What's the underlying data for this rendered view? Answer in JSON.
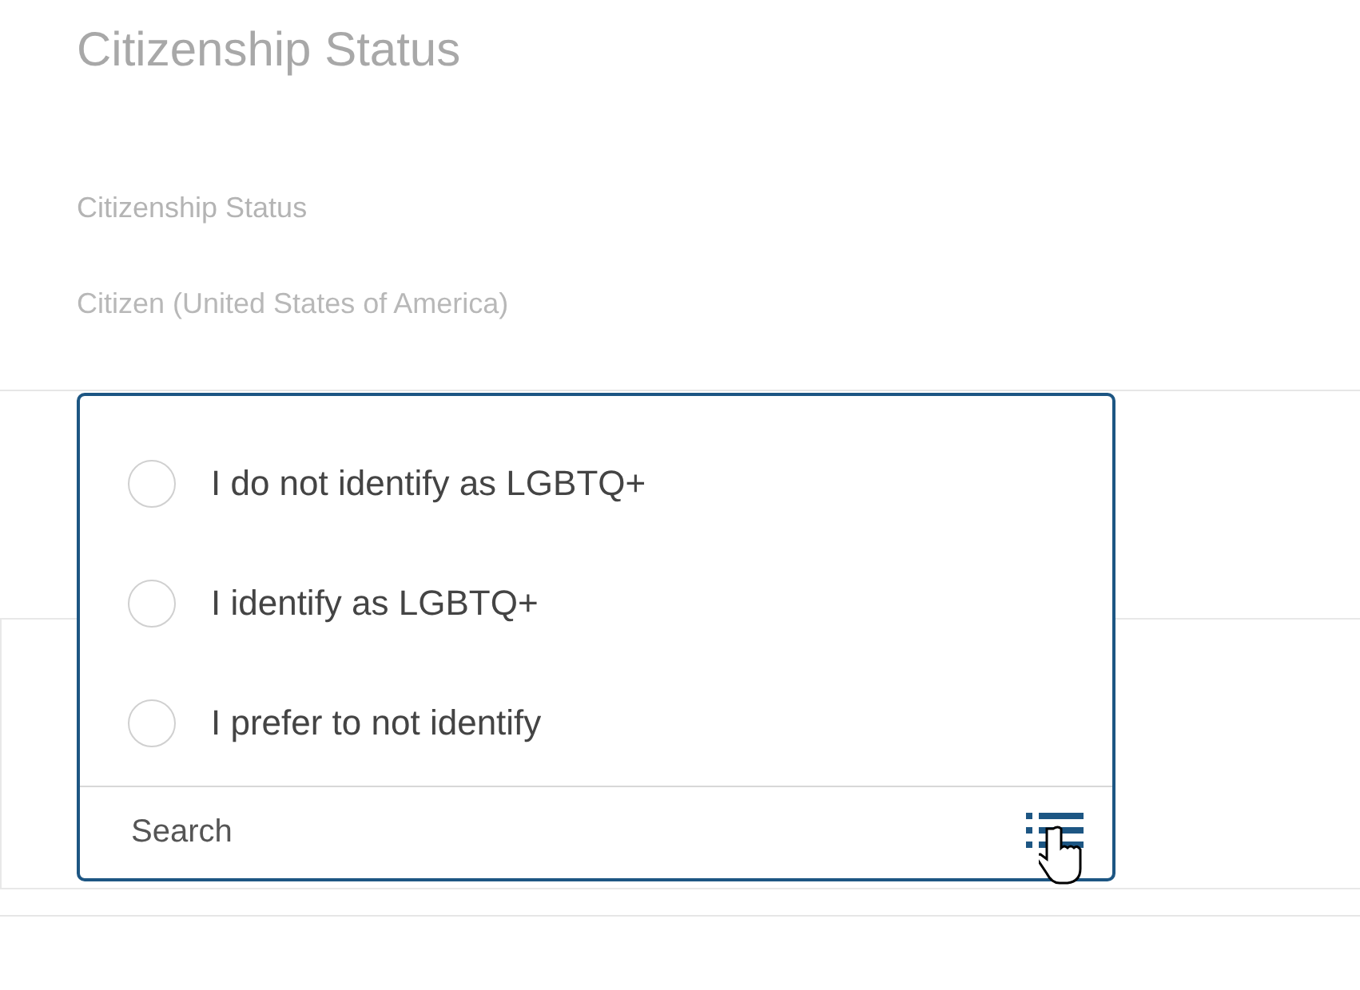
{
  "section": {
    "title": "Citizenship Status"
  },
  "field": {
    "label": "Citizenship Status",
    "value": "Citizen (United States of America)"
  },
  "dropdown": {
    "options": [
      {
        "label": "I do not identify as LGBTQ+",
        "selected": false
      },
      {
        "label": "I identify as LGBTQ+",
        "selected": false
      },
      {
        "label": "I prefer to not identify",
        "selected": false
      }
    ],
    "search": {
      "placeholder": "Search"
    }
  }
}
